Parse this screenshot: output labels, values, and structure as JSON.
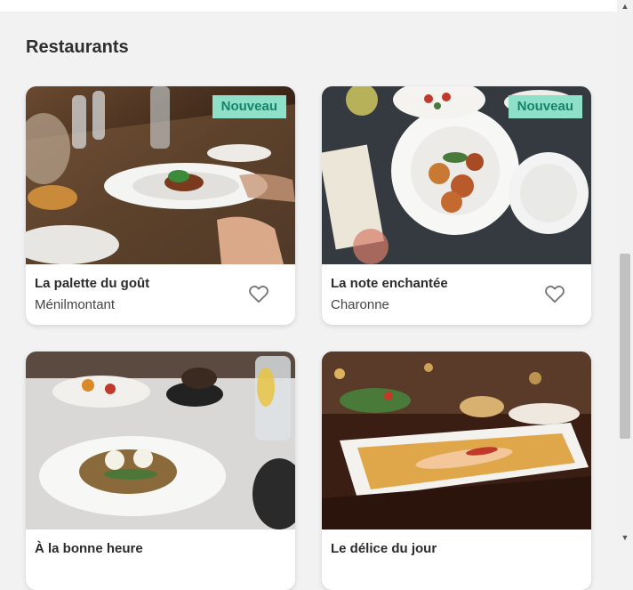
{
  "section": {
    "title": "Restaurants"
  },
  "restaurants": [
    {
      "name": "La palette du goût",
      "location": "Ménilmontant",
      "badge": "Nouveau"
    },
    {
      "name": "La note enchantée",
      "location": "Charonne",
      "badge": "Nouveau"
    },
    {
      "name": "À la bonne heure",
      "location": ""
    },
    {
      "name": "Le délice du jour",
      "location": ""
    }
  ],
  "colors": {
    "badge_bg": "#8fe0c9",
    "badge_text": "#16836b",
    "background": "#f2f2f2"
  },
  "icons": {
    "favorite": "heart-outline-icon"
  }
}
